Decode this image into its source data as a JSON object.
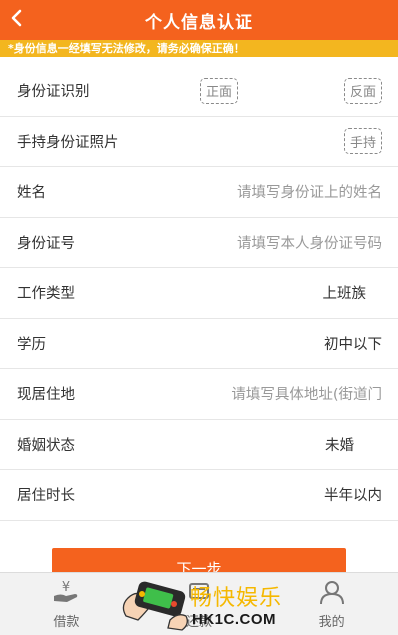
{
  "header": {
    "title": "个人信息认证",
    "back_icon": "chevron-left-icon"
  },
  "notice": {
    "text": "*身份信息一经填写无法修改，请务必确保正确！"
  },
  "form": {
    "id_recognition": {
      "label": "身份证识别",
      "front": "正面",
      "back": "反面"
    },
    "hand_photo": {
      "label": "手持身份证照片",
      "button": "手持"
    },
    "name": {
      "label": "姓名",
      "placeholder": "请填写身份证上的姓名"
    },
    "id_number": {
      "label": "身份证号",
      "placeholder": "请填写本人身份证号码"
    },
    "job_type": {
      "label": "工作类型",
      "value": "上班族"
    },
    "education": {
      "label": "学历",
      "value": "初中以下"
    },
    "address": {
      "label": "现居住地",
      "placeholder": "请填写具体地址(街道门"
    },
    "marital": {
      "label": "婚姻状态",
      "value": "未婚"
    },
    "residence_time": {
      "label": "居住时长",
      "value": "半年以内"
    }
  },
  "next_button": {
    "label": "下一步"
  },
  "tabbar": {
    "items": [
      {
        "label": "借款",
        "icon": "yen-hand-icon"
      },
      {
        "label": "还款",
        "icon": "repay-icon"
      },
      {
        "label": "我的",
        "icon": "user-icon"
      }
    ]
  },
  "watermark": {
    "cn": "畅快娱乐",
    "en": "HK1C.COM"
  },
  "colors": {
    "primary": "#f4621e",
    "notice_bg": "#f3b61f",
    "watermark": "#f5b800"
  }
}
